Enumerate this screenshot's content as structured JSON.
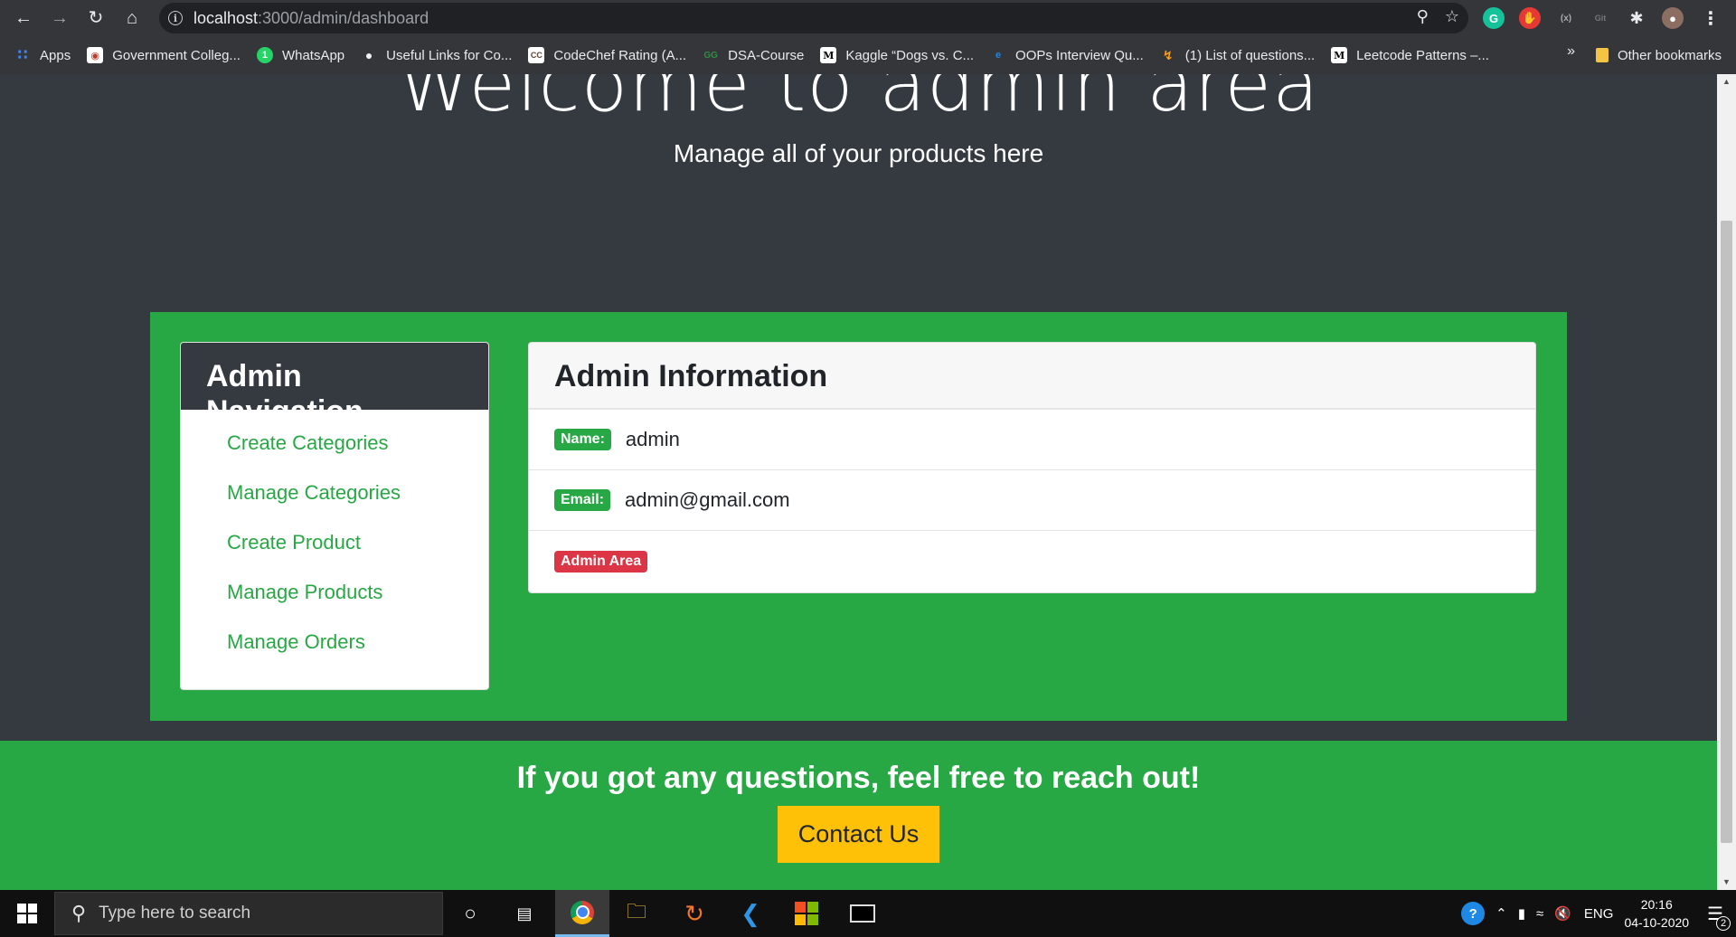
{
  "browser": {
    "url_host": "localhost",
    "url_path": ":3000/admin/dashboard",
    "bookmarks": [
      {
        "label": "Apps",
        "icon": "apps-grid-icon",
        "color": "#4285f4"
      },
      {
        "label": "Government Colleg...",
        "icon": "college-icon",
        "color": "#c0392b"
      },
      {
        "label": "WhatsApp",
        "icon": "whatsapp-icon",
        "color": "#25d366"
      },
      {
        "label": "Useful Links for Co...",
        "icon": "lightbulb-icon",
        "color": "#f1f1f1"
      },
      {
        "label": "CodeChef Rating (A...",
        "icon": "codechef-icon",
        "color": "#5b4638"
      },
      {
        "label": "DSA-Course",
        "icon": "geeksforgeeks-icon",
        "color": "#2f8d46"
      },
      {
        "label": "Kaggle “Dogs vs. C...",
        "icon": "medium-icon",
        "color": "#ffffff"
      },
      {
        "label": "OOPs Interview Qu...",
        "icon": "edge-icon",
        "color": "#1e88e5"
      },
      {
        "label": "(1) List of questions...",
        "icon": "leetcode-icon",
        "color": "#f89f1b"
      },
      {
        "label": "Leetcode Patterns –...",
        "icon": "medium-icon",
        "color": "#ffffff"
      }
    ],
    "bookmarks_more": "»",
    "other_bookmarks": "Other bookmarks"
  },
  "hero": {
    "title": "Welcome to admin area",
    "subtitle": "Manage all of your products here"
  },
  "admin_nav": {
    "title": "Admin Navigation",
    "items": [
      "Create Categories",
      "Manage Categories",
      "Create Product",
      "Manage Products",
      "Manage Orders"
    ]
  },
  "admin_info": {
    "title": "Admin Information",
    "name_label": "Name:",
    "name_value": "admin",
    "email_label": "Email:",
    "email_value": "admin@gmail.com",
    "area_badge": "Admin Area"
  },
  "footer": {
    "message": "If you got any questions, feel free to reach out!",
    "contact_label": "Contact Us"
  },
  "taskbar": {
    "search_placeholder": "Type here to search",
    "language": "ENG",
    "time": "20:16",
    "date": "04-10-2020",
    "notification_count": "2"
  },
  "colors": {
    "primary_green": "#28a745",
    "dark": "#343a40",
    "warning": "#ffc107",
    "danger": "#dc3545"
  }
}
